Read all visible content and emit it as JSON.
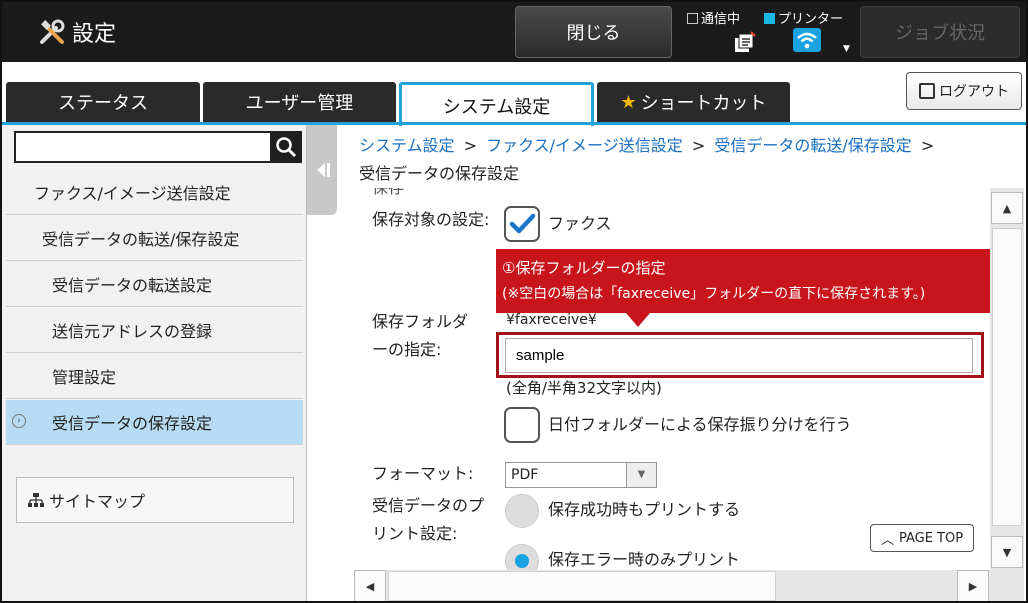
{
  "header": {
    "title": "設定",
    "close_label": "閉じる",
    "status_comm_label": "通信中",
    "status_printer_label": "プリンター",
    "job_status_label": "ジョブ状況"
  },
  "tabs": [
    {
      "label": "ステータス"
    },
    {
      "label": "ユーザー管理"
    },
    {
      "label": "システム設定"
    },
    {
      "label": "ショートカット"
    }
  ],
  "logout_label": "ログアウト",
  "sidebar": {
    "search_value": "",
    "items": [
      {
        "label": "ファクス/イメージ送信設定"
      },
      {
        "label": "受信データの転送/保存設定"
      },
      {
        "label": "受信データの転送設定"
      },
      {
        "label": "送信元アドレスの登録"
      },
      {
        "label": "管理設定"
      },
      {
        "label": "受信データの保存設定"
      }
    ],
    "sitemap_label": "サイトマップ"
  },
  "breadcrumb": {
    "links": [
      "システム設定",
      "ファクス/イメージ送信設定",
      "受信データの転送/保存設定"
    ],
    "separator": ">",
    "current": "受信データの保存設定"
  },
  "form": {
    "partial_top": "保存",
    "target_label": "保存対象の設定:",
    "target_option": "ファクス",
    "folder_label": "保存フォルダーの指定:",
    "folder_prefix": "¥faxreceive¥",
    "folder_value": "sample",
    "folder_hint": "(全角/半角32文字以内)",
    "date_folder_label": "日付フォルダーによる保存振り分けを行う",
    "format_label": "フォーマット:",
    "format_value": "PDF",
    "print_label": "受信データのプリント設定:",
    "print_option1": "保存成功時もプリントする",
    "print_option2": "保存エラー時のみプリント"
  },
  "callout": {
    "line1": "①保存フォルダーの指定",
    "line2": "(※空白の場合は「faxreceive」フォルダーの直下に保存されます。)"
  },
  "pagetop_label": "PAGE TOP",
  "colors": {
    "accent": "#20a2dc",
    "callout": "#c8151c",
    "header_bg": "#1b1b1b",
    "active_nav": "#b7dbf2"
  }
}
